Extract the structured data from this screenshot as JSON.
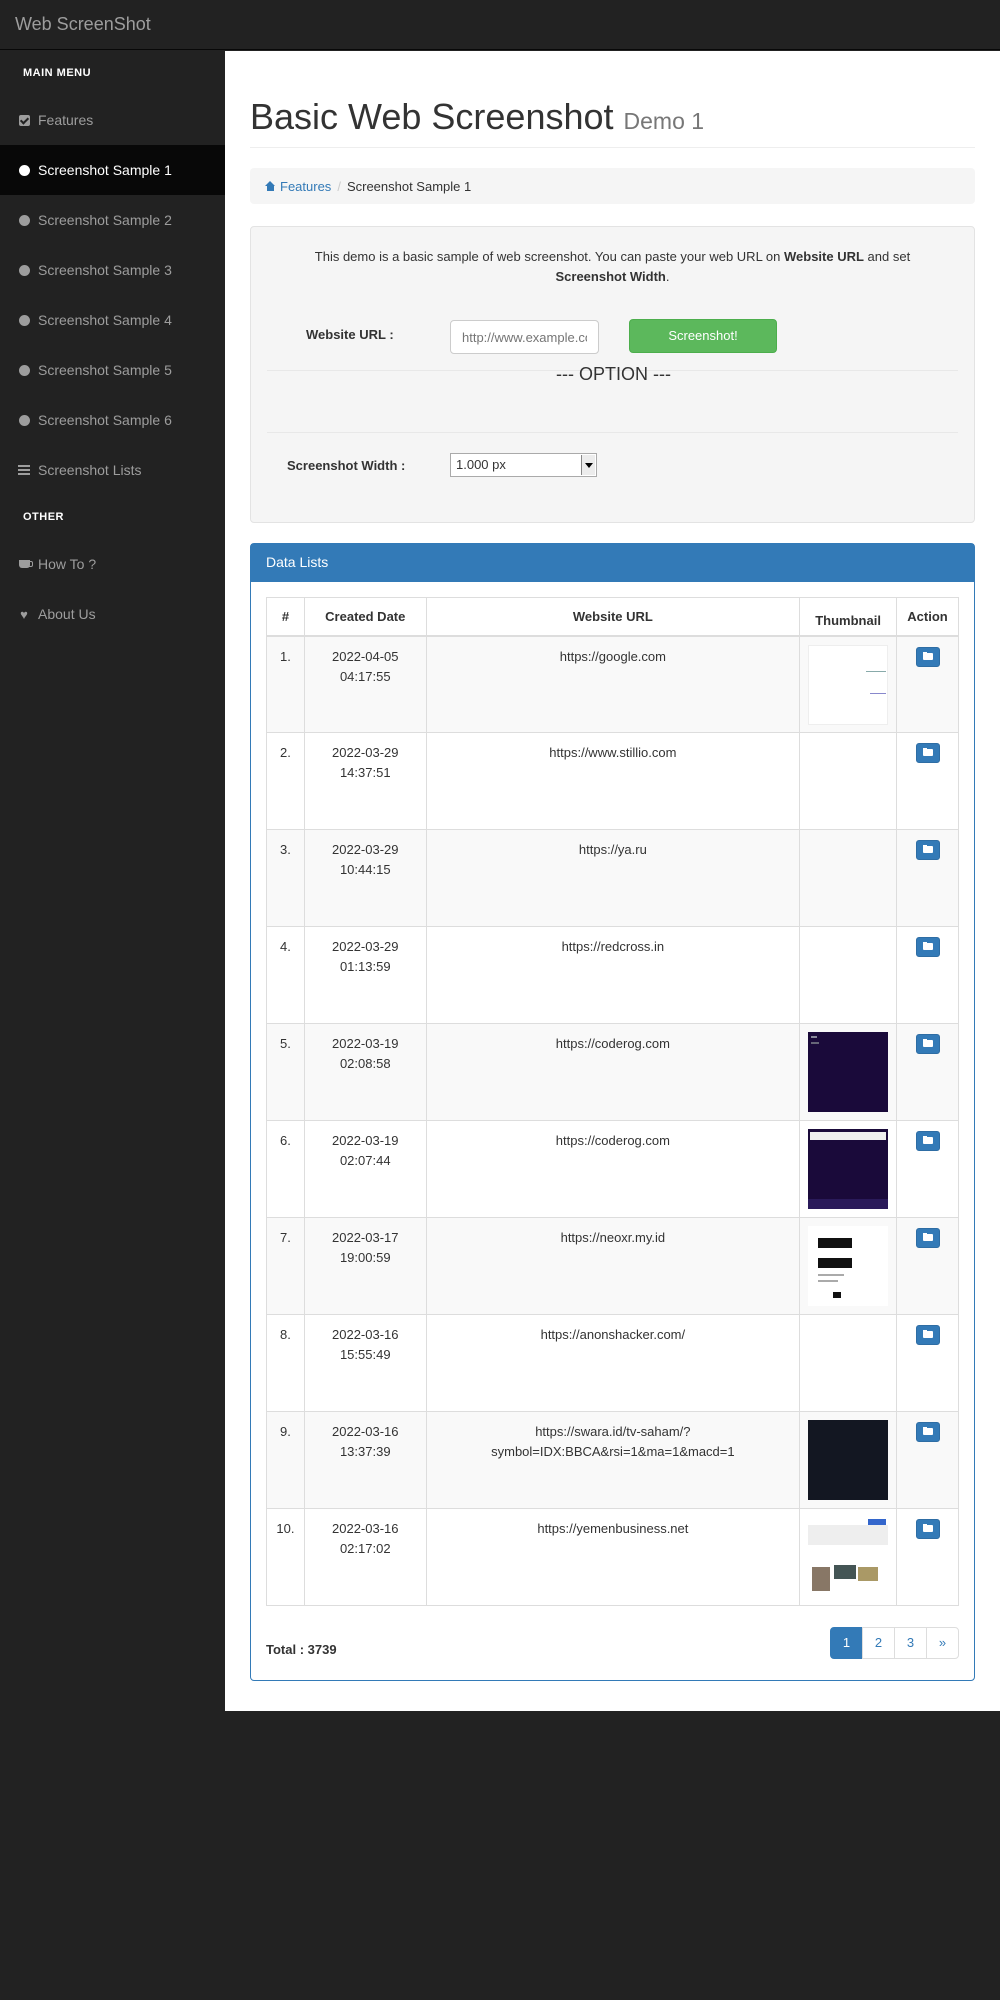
{
  "app": {
    "brand": "Web ScreenShot"
  },
  "sidebar": {
    "main_menu_header": "MAIN MENU",
    "other_header": "OTHER",
    "items": [
      {
        "label": "Features",
        "icon": "check-square-icon"
      },
      {
        "label": "Screenshot Sample 1",
        "icon": "circle-icon",
        "active": true
      },
      {
        "label": "Screenshot Sample 2",
        "icon": "circle-icon"
      },
      {
        "label": "Screenshot Sample 3",
        "icon": "circle-icon"
      },
      {
        "label": "Screenshot Sample 4",
        "icon": "circle-icon"
      },
      {
        "label": "Screenshot Sample 5",
        "icon": "circle-icon"
      },
      {
        "label": "Screenshot Sample 6",
        "icon": "circle-icon"
      },
      {
        "label": "Screenshot Lists",
        "icon": "list-icon"
      }
    ],
    "other_items": [
      {
        "label": "How To ?",
        "icon": "coffee-icon"
      },
      {
        "label": "About Us",
        "icon": "heart-icon"
      }
    ]
  },
  "page": {
    "title": "Basic Web Screenshot",
    "subtitle": "Demo 1"
  },
  "breadcrumb": {
    "home": "Features",
    "current": "Screenshot Sample 1"
  },
  "form": {
    "desc_part1": "This demo is a basic sample of web screenshot. You can paste your web URL on ",
    "desc_bold1": "Website URL",
    "desc_part2": " and set ",
    "desc_bold2": "Screenshot Width",
    "desc_part3": ".",
    "url_label": "Website URL :",
    "url_placeholder": "http://www.example.com",
    "submit_label": "Screenshot!",
    "option_heading": "--- OPTION ---",
    "width_label": "Screenshot Width :",
    "width_value": "1.000 px"
  },
  "data_list": {
    "heading": "Data Lists",
    "columns": [
      "#",
      "Created Date",
      "Website URL",
      "Thumbnail",
      "Action"
    ],
    "rows": [
      {
        "num": "1.",
        "date": "2022-04-05",
        "time": "04:17:55",
        "url": "https://google.com",
        "thumb": "white"
      },
      {
        "num": "2.",
        "date": "2022-03-29",
        "time": "14:37:51",
        "url": "https://www.stillio.com",
        "thumb": "none"
      },
      {
        "num": "3.",
        "date": "2022-03-29",
        "time": "10:44:15",
        "url": "https://ya.ru",
        "thumb": "none"
      },
      {
        "num": "4.",
        "date": "2022-03-29",
        "time": "01:13:59",
        "url": "https://redcross.in",
        "thumb": "none"
      },
      {
        "num": "5.",
        "date": "2022-03-19",
        "time": "02:08:58",
        "url": "https://coderog.com",
        "thumb": "purple"
      },
      {
        "num": "6.",
        "date": "2022-03-19",
        "time": "02:07:44",
        "url": "https://coderog.com",
        "thumb": "purple2"
      },
      {
        "num": "7.",
        "date": "2022-03-17",
        "time": "19:00:59",
        "url": "https://neoxr.my.id",
        "thumb": "doc"
      },
      {
        "num": "8.",
        "date": "2022-03-16",
        "time": "15:55:49",
        "url": "https://anonshacker.com/",
        "thumb": "none"
      },
      {
        "num": "9.",
        "date": "2022-03-16",
        "time": "13:37:39",
        "url": "https://swara.id/tv-saham/?symbol=IDX:BBCA&rsi=1&ma=1&macd=1",
        "thumb": "dark"
      },
      {
        "num": "10.",
        "date": "2022-03-16",
        "time": "02:17:02",
        "url": "https://yemenbusiness.net",
        "thumb": "news"
      }
    ],
    "total_label": "Total : 3739",
    "pages": [
      "1",
      "2",
      "3",
      "»"
    ],
    "current_page": "1"
  },
  "colors": {
    "primary": "#337ab7",
    "success": "#5cb85c",
    "sidebar_bg": "#222222"
  }
}
